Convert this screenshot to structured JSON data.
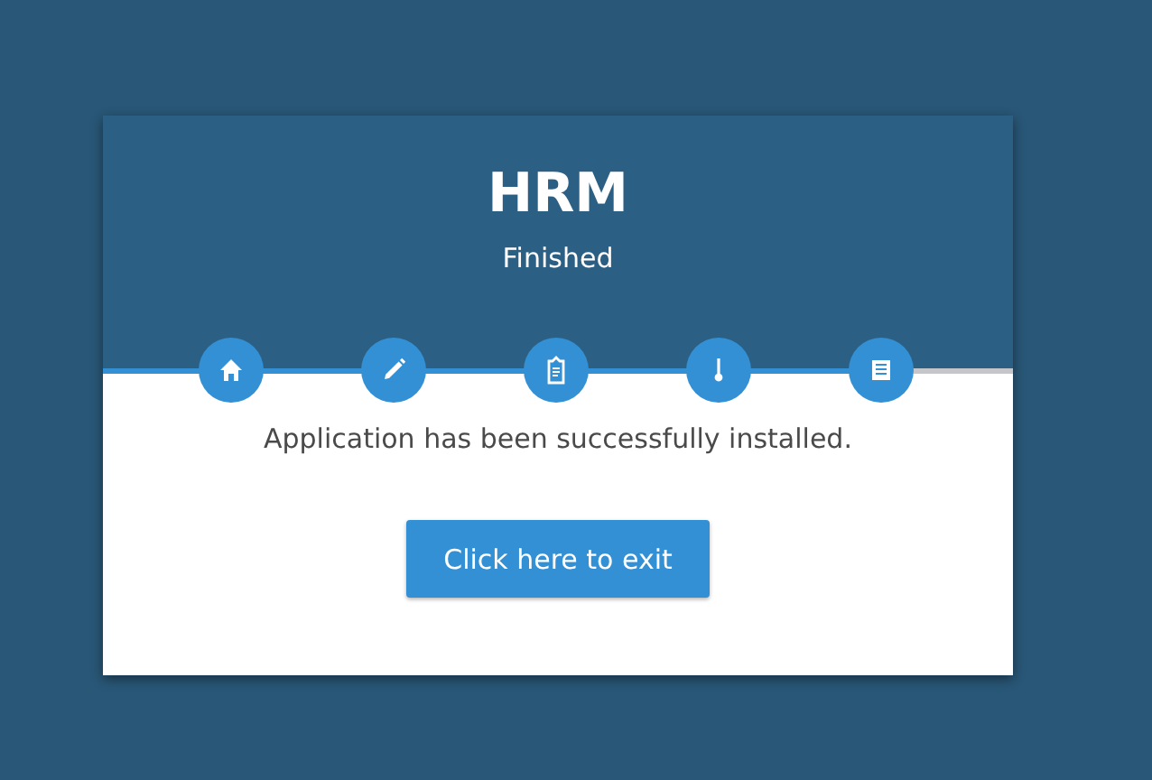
{
  "header": {
    "title": "HRM",
    "subtitle": "Finished"
  },
  "progress": {
    "level": 0.857
  },
  "steps": [
    {
      "kind": "home"
    },
    {
      "kind": "pencil"
    },
    {
      "kind": "clipboard"
    },
    {
      "kind": "thermometer"
    },
    {
      "kind": "list"
    }
  ],
  "message": "Application has been successfully installed.",
  "button": "Click here to exit"
}
